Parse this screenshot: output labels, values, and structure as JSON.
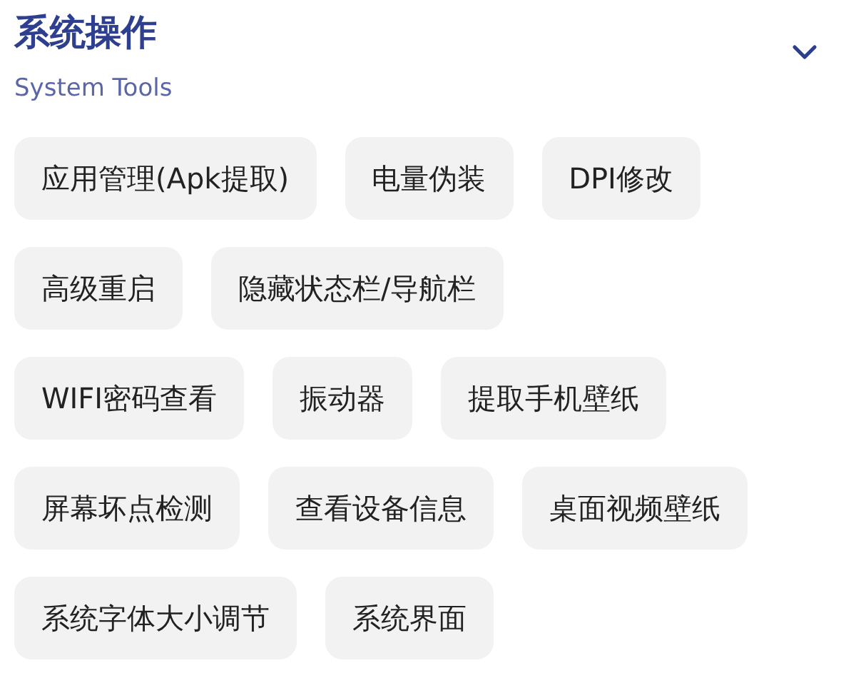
{
  "section": {
    "title": "系统操作",
    "subtitle": "System Tools",
    "expanded": true
  },
  "tool_rows": [
    [
      "应用管理(Apk提取)",
      "电量伪装",
      "DPI修改"
    ],
    [
      "高级重启",
      "隐藏状态栏/导航栏"
    ],
    [
      "WIFI密码查看",
      "振动器",
      "提取手机壁纸"
    ],
    [
      "屏幕坏点检测",
      "查看设备信息",
      "桌面视频壁纸"
    ],
    [
      "系统字体大小调节",
      "系统界面"
    ]
  ]
}
